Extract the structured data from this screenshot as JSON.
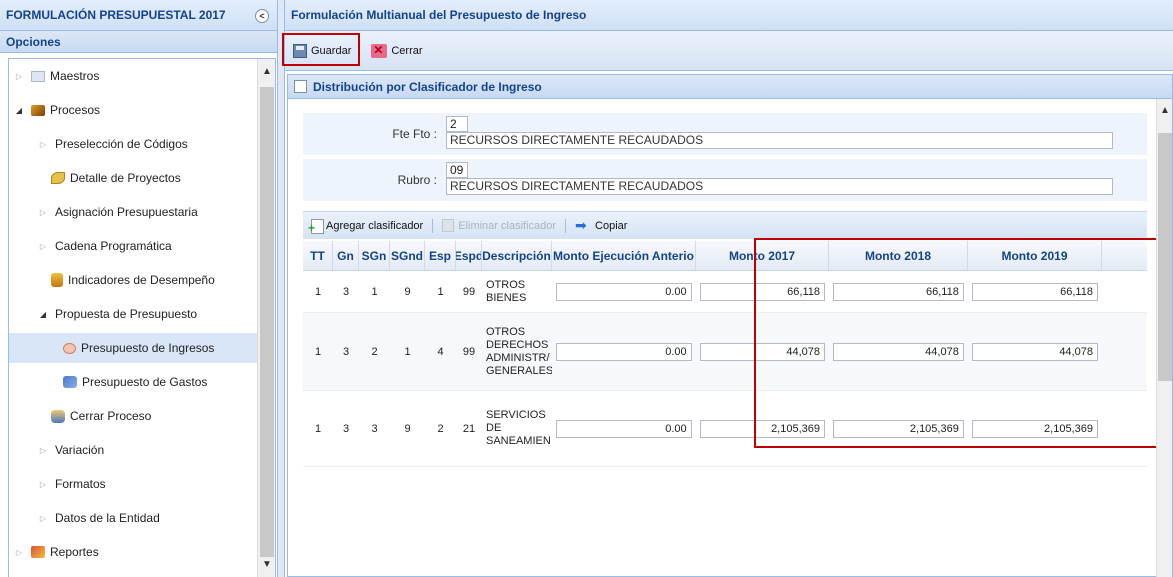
{
  "left_panel": {
    "title": "FORMULACIÓN PRESUPUESTAL 2017",
    "section": "Opciones",
    "tree": [
      {
        "label": "Maestros",
        "arrow": "▷",
        "level": 0,
        "icon": "folder-icon"
      },
      {
        "label": "Procesos",
        "arrow": "◢",
        "level": 0,
        "icon": "folder-open-icon"
      },
      {
        "label": "Preselección de Códigos",
        "arrow": "▷",
        "level": 1,
        "icon": ""
      },
      {
        "label": "Detalle de Proyectos",
        "arrow": "",
        "level": 2,
        "icon": "leaf-icon"
      },
      {
        "label": "Asignación Presupuestaria",
        "arrow": "▷",
        "level": 1,
        "icon": ""
      },
      {
        "label": "Cadena Programática",
        "arrow": "▷",
        "level": 1,
        "icon": ""
      },
      {
        "label": "Indicadores de Desempeño",
        "arrow": "",
        "level": 2,
        "icon": "indicator-icon"
      },
      {
        "label": "Propuesta de Presupuesto",
        "arrow": "◢",
        "level": 1,
        "icon": ""
      },
      {
        "label": "Presupuesto de Ingresos",
        "arrow": "",
        "level": 3,
        "icon": "income-icon",
        "selected": true
      },
      {
        "label": "Presupuesto de Gastos",
        "arrow": "",
        "level": 3,
        "icon": "expense-icon"
      },
      {
        "label": "Cerrar Proceso",
        "arrow": "",
        "level": 2,
        "icon": "close-process-icon"
      },
      {
        "label": "Variación",
        "arrow": "▷",
        "level": 1,
        "icon": ""
      },
      {
        "label": "Formatos",
        "arrow": "▷",
        "level": 1,
        "icon": ""
      },
      {
        "label": "Datos de la Entidad",
        "arrow": "▷",
        "level": 1,
        "icon": ""
      },
      {
        "label": "Reportes",
        "arrow": "▷",
        "level": 0,
        "icon": "reports-icon"
      }
    ]
  },
  "right_panel": {
    "title": "Formulación Multianual del Presupuesto de Ingreso",
    "toolbar": {
      "save_label": "Guardar",
      "close_label": "Cerrar"
    },
    "subpanel_title": "Distribución por Clasificador de Ingreso",
    "form": {
      "fte_label": "Fte Fto :",
      "fte_code": "2",
      "fte_desc": "RECURSOS DIRECTAMENTE RECAUDADOS",
      "rubro_label": "Rubro :",
      "rubro_code": "09",
      "rubro_desc": "RECURSOS DIRECTAMENTE RECAUDADOS"
    },
    "grid_toolbar": {
      "add_label": "Agregar clasificador",
      "delete_label": "Eliminar clasificador",
      "copy_label": "Copiar"
    },
    "grid": {
      "columns": [
        "TT",
        "Gn",
        "SGn",
        "SGnd",
        "Esp",
        "Espd",
        "Descripción",
        "Monto Ejecución Anterio",
        "Monto 2017",
        "Monto 2018",
        "Monto 2019"
      ],
      "rows": [
        {
          "tt": "1",
          "gn": "3",
          "sgn": "1",
          "sgnd": "9",
          "esp": "1",
          "espd": "99",
          "desc": [
            "OTROS",
            "BIENES"
          ],
          "prev": "0.00",
          "m2017": "66,118",
          "m2018": "66,118",
          "m2019": "66,118"
        },
        {
          "tt": "1",
          "gn": "3",
          "sgn": "2",
          "sgnd": "1",
          "esp": "4",
          "espd": "99",
          "desc": [
            "OTROS",
            "DERECHOS",
            "ADMINISTR/",
            "GENERALES"
          ],
          "prev": "0.00",
          "m2017": "44,078",
          "m2018": "44,078",
          "m2019": "44,078"
        },
        {
          "tt": "1",
          "gn": "3",
          "sgn": "3",
          "sgnd": "9",
          "esp": "2",
          "espd": "21",
          "desc": [
            "SERVICIOS",
            "DE",
            "SANEAMIEN"
          ],
          "prev": "0.00",
          "m2017": "2,105,369",
          "m2018": "2,105,369",
          "m2019": "2,105,369"
        }
      ]
    }
  },
  "colors": {
    "header_text": "#15428b",
    "highlight": "#c00000",
    "selected_row": "#d8e6f8"
  }
}
